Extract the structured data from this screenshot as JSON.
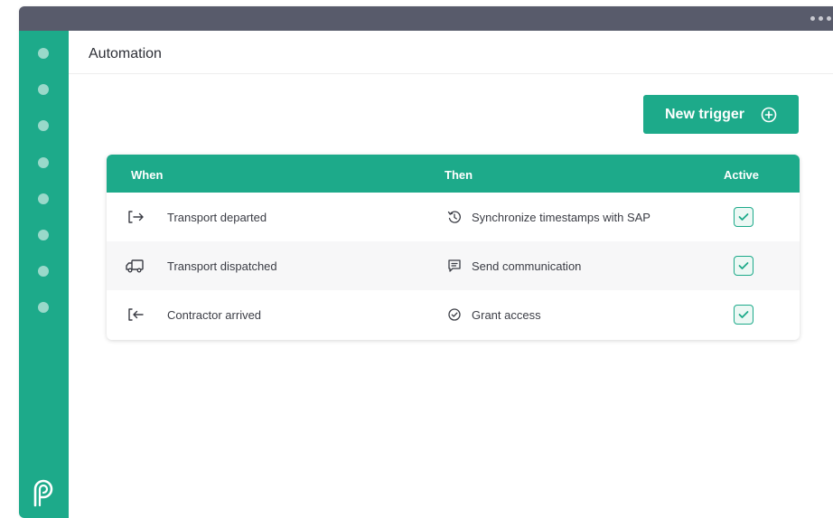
{
  "header": {
    "title": "Automation"
  },
  "actions": {
    "new_trigger_label": "New trigger",
    "new_trigger_icon": "plus-circle-icon"
  },
  "table": {
    "columns": {
      "when": "When",
      "then": "Then",
      "active": "Active"
    },
    "rows": [
      {
        "when": "Transport departed",
        "when_icon": "exit-arrow-icon",
        "then": "Synchronize timestamps with SAP",
        "then_icon": "history-icon",
        "active": true
      },
      {
        "when": "Transport dispatched",
        "when_icon": "truck-icon",
        "then": "Send communication",
        "then_icon": "message-icon",
        "active": true
      },
      {
        "when": "Contractor arrived",
        "when_icon": "enter-arrow-icon",
        "then": "Grant access",
        "then_icon": "check-circle-icon",
        "active": true
      }
    ]
  },
  "colors": {
    "accent": "#1daa8a",
    "titlebar": "#585b6b",
    "text": "#2d2f36"
  },
  "sidebar": {
    "logo_icon": "brand-logo-icon",
    "item_count": 8
  }
}
